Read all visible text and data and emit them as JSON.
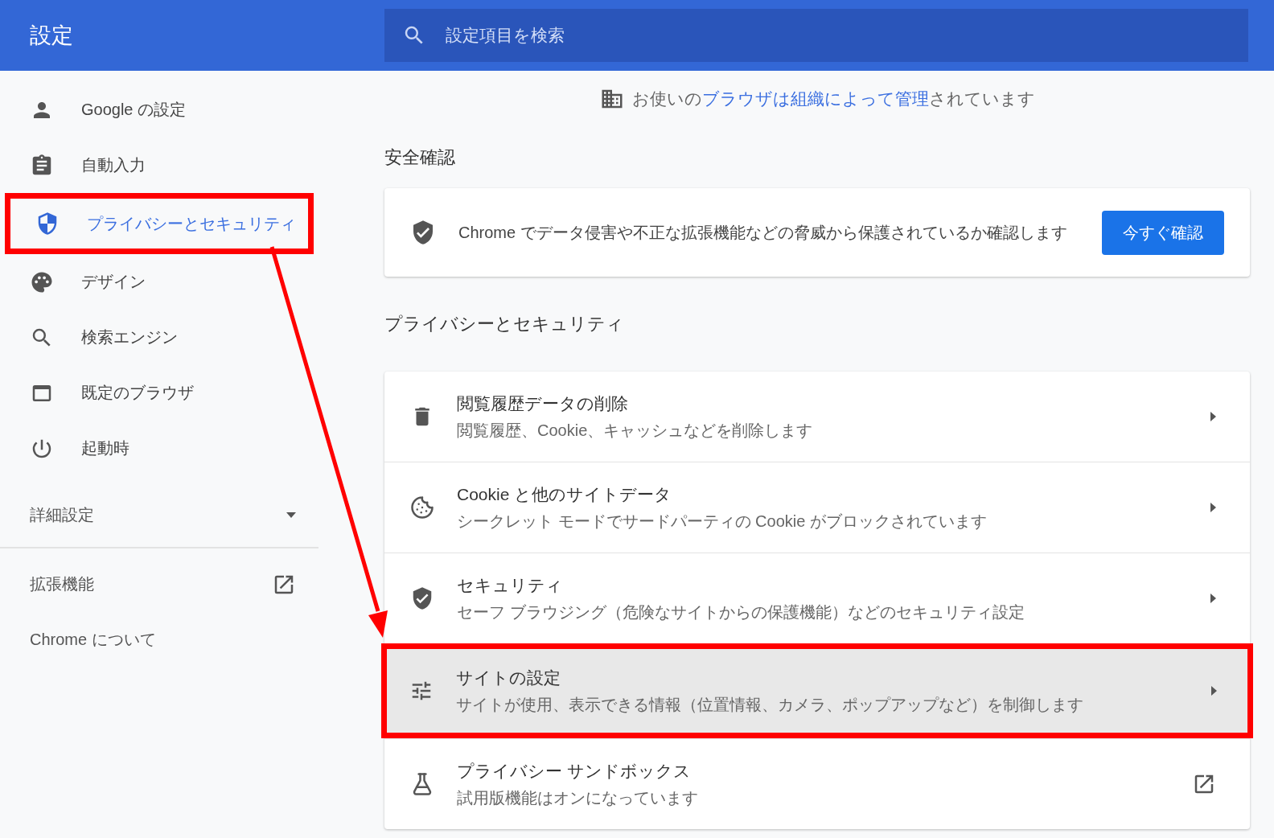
{
  "header": {
    "title": "設定",
    "search": {
      "placeholder": "設定項目を検索"
    }
  },
  "sidebar": {
    "items": [
      {
        "label": "Google の設定",
        "selected": false,
        "highlighted": false
      },
      {
        "label": "自動入力",
        "selected": false,
        "highlighted": false
      },
      {
        "label": "プライバシーとセキュリティ",
        "selected": true,
        "highlighted": true
      },
      {
        "label": "デザイン",
        "selected": false,
        "highlighted": false
      },
      {
        "label": "検索エンジン",
        "selected": false,
        "highlighted": false
      },
      {
        "label": "既定のブラウザ",
        "selected": false,
        "highlighted": false
      },
      {
        "label": "起動時",
        "selected": false,
        "highlighted": false
      }
    ],
    "advanced": {
      "label": "詳細設定",
      "expanded": false
    },
    "links": [
      {
        "label": "拡張機能",
        "external": true
      },
      {
        "label": "Chrome について",
        "external": false
      }
    ]
  },
  "managed_notice": {
    "before": "お使いの",
    "link": "ブラウザは組織によって管理",
    "after": "されています"
  },
  "safety_check": {
    "heading": "安全確認",
    "text": "Chrome でデータ侵害や不正な拡張機能などの脅威から保護されているか確認します",
    "button": "今すぐ確認"
  },
  "privacy": {
    "heading": "プライバシーとセキュリティ",
    "rows": [
      {
        "title": "閲覧履歴データの削除",
        "subtitle": "閲覧履歴、Cookie、キャッシュなどを削除します",
        "external": false,
        "highlighted": false
      },
      {
        "title": "Cookie と他のサイトデータ",
        "subtitle": "シークレット モードでサードパーティの Cookie がブロックされています",
        "external": false,
        "highlighted": false
      },
      {
        "title": "セキュリティ",
        "subtitle": "セーフ ブラウジング（危険なサイトからの保護機能）などのセキュリティ設定",
        "external": false,
        "highlighted": false
      },
      {
        "title": "サイトの設定",
        "subtitle": "サイトが使用、表示できる情報（位置情報、カメラ、ポップアップなど）を制御します",
        "external": false,
        "highlighted": true
      },
      {
        "title": "プライバシー サンドボックス",
        "subtitle": "試用版機能はオンになっています",
        "external": true,
        "highlighted": false
      }
    ]
  },
  "annotation": {
    "arrow": true
  }
}
